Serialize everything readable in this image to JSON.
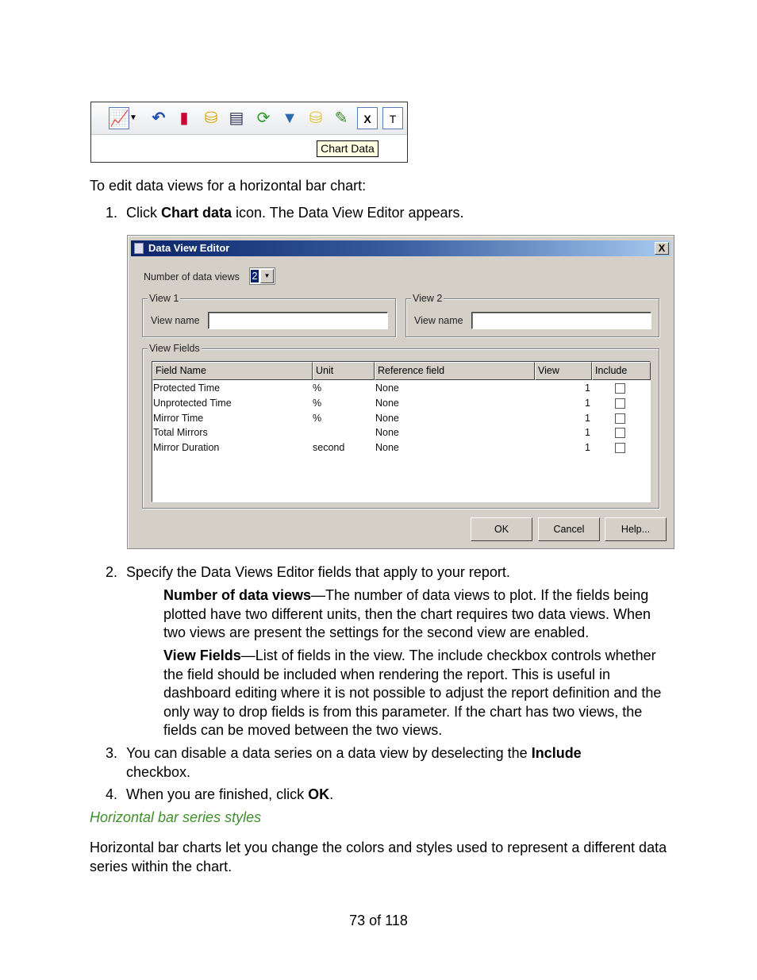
{
  "toolbar": {
    "icons": [
      "line-chart-icon",
      "dropdown-arrow-icon",
      "undo-icon",
      "edit-bar-chart-icon",
      "chart-database-icon",
      "chart-legend-icon",
      "refresh-timer-icon",
      "filter-icon",
      "chart-data-icon",
      "edit-line-chart-icon",
      "x-axis-icon",
      "title-icon"
    ],
    "tooltip": "Chart Data"
  },
  "intro": "To edit data views for a horizontal bar chart:",
  "steps": [
    {
      "num": "1.",
      "pre": "Click ",
      "bold": "Chart data",
      "post": " icon. The Data View Editor appears."
    },
    {
      "num": "2.",
      "text": "Specify the Data Views Editor fields that apply to your report."
    },
    {
      "num": "3.",
      "pre": "You can disable a data series on a data view by deselecting the ",
      "bold": "Include",
      "post": " checkbox."
    },
    {
      "num": "4.",
      "pre": "When you are finished, click ",
      "bold": "OK",
      "post": "."
    }
  ],
  "dialog": {
    "title": "Data View Editor",
    "close": "X",
    "num_views_label": "Number of data views",
    "num_views_value": "2",
    "view1": {
      "legend": "View 1",
      "name_label": "View name",
      "name_value": ""
    },
    "view2": {
      "legend": "View 2",
      "name_label": "View name",
      "name_value": ""
    },
    "fields_legend": "View Fields",
    "columns": [
      "Field Name",
      "Unit",
      "Reference field",
      "View",
      "Include"
    ],
    "rows": [
      {
        "field": "Protected Time",
        "unit": "%",
        "ref": "None",
        "view": "1",
        "include": false
      },
      {
        "field": "Unprotected Time",
        "unit": "%",
        "ref": "None",
        "view": "1",
        "include": false
      },
      {
        "field": "Mirror Time",
        "unit": "%",
        "ref": "None",
        "view": "1",
        "include": false
      },
      {
        "field": "Total Mirrors",
        "unit": "",
        "ref": "None",
        "view": "1",
        "include": false
      },
      {
        "field": "Mirror Duration",
        "unit": "second",
        "ref": "None",
        "view": "1",
        "include": false
      }
    ],
    "buttons": {
      "ok": "OK",
      "cancel": "Cancel",
      "help": "Help..."
    }
  },
  "defs": [
    {
      "term": "Number of data views",
      "desc": "—The number of data views to plot. If the fields being plotted have two different units, then the chart requires two data views. When two views are present the settings for the second view are enabled."
    },
    {
      "term": "View Fields",
      "desc": "—List of fields in the view. The include checkbox controls whether the field should be included when rendering the report. This is useful in dashboard editing where it is not possible to adjust the report definition and the only way to drop fields is from this parameter. If the chart has two views, the fields can be moved between the two views."
    }
  ],
  "section_heading": "Horizontal bar series styles",
  "section_text": "Horizontal bar charts let you change the colors and styles used to represent a different data series within the chart.",
  "footer": "73 of 118",
  "colors": {
    "heading": "#3e8f2a",
    "dialog_bg": "#d4d0c8",
    "titlebar": "#0a246a"
  }
}
